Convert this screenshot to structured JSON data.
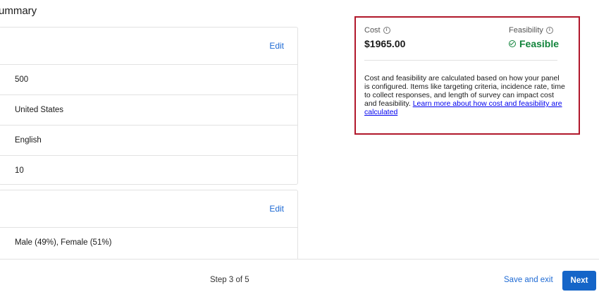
{
  "page": {
    "title": "ummary"
  },
  "card1": {
    "edit_label": "Edit",
    "rows": [
      "500",
      "United States",
      "English",
      "10"
    ]
  },
  "card2": {
    "edit_label": "Edit",
    "rows": [
      "Male (49%), Female (51%)"
    ]
  },
  "summary": {
    "cost_label": "Cost",
    "cost_value": "$1965.00",
    "feasibility_label": "Feasibility",
    "feasibility_value": "Feasible",
    "description": "Cost and feasibility are calculated based on how your panel is configured. Items like targeting criteria, incidence rate, time to collect responses, and length of survey can impact cost and feasibility. ",
    "learn_more_link": "Learn more about how cost and feasibility are calculated",
    "status_color": "#12843c",
    "highlight_border_color": "#b1182b"
  },
  "footer": {
    "step_text": "Step 3 of 5",
    "save_exit_label": "Save and exit",
    "next_label": "Next"
  }
}
